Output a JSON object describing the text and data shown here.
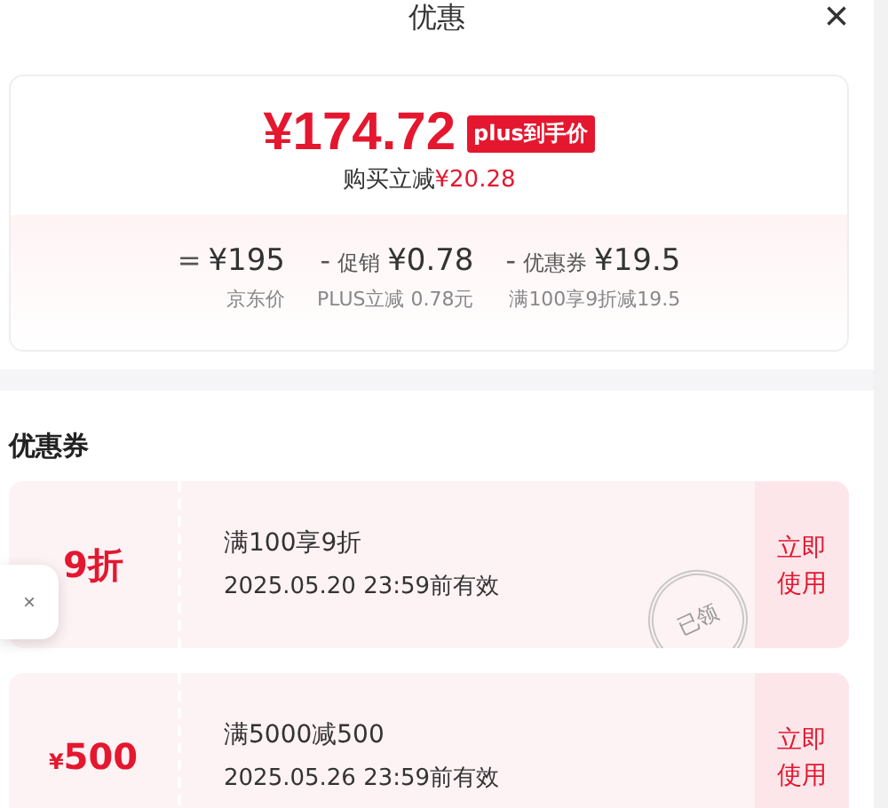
{
  "header": {
    "title": "优惠",
    "close": "×"
  },
  "summary": {
    "price": "¥174.72",
    "badge": "plus到手价",
    "saving_label": "购买立减",
    "saving": "¥20.28",
    "breakdown": [
      {
        "op": "=",
        "value": "¥195",
        "note": "京东价"
      },
      {
        "op": "-",
        "label": "促销",
        "value": "¥0.78",
        "note": "PLUS立减 0.78元"
      },
      {
        "op": "-",
        "label": "优惠券",
        "value": "¥19.5",
        "note": "满100享9折减19.5"
      }
    ]
  },
  "coupons_title": "优惠券",
  "coupons": [
    {
      "kind": "discount",
      "amount": "9折",
      "condition": "满100享9折",
      "validity": "2025.05.20 23:59前有效",
      "stamp": "已领",
      "action": "立即使用"
    },
    {
      "kind": "cash",
      "currency": "¥",
      "amount": "500",
      "condition": "满5000减500",
      "validity": "2025.05.26 23:59前有效",
      "action": "立即使用"
    }
  ],
  "float_close": "×"
}
